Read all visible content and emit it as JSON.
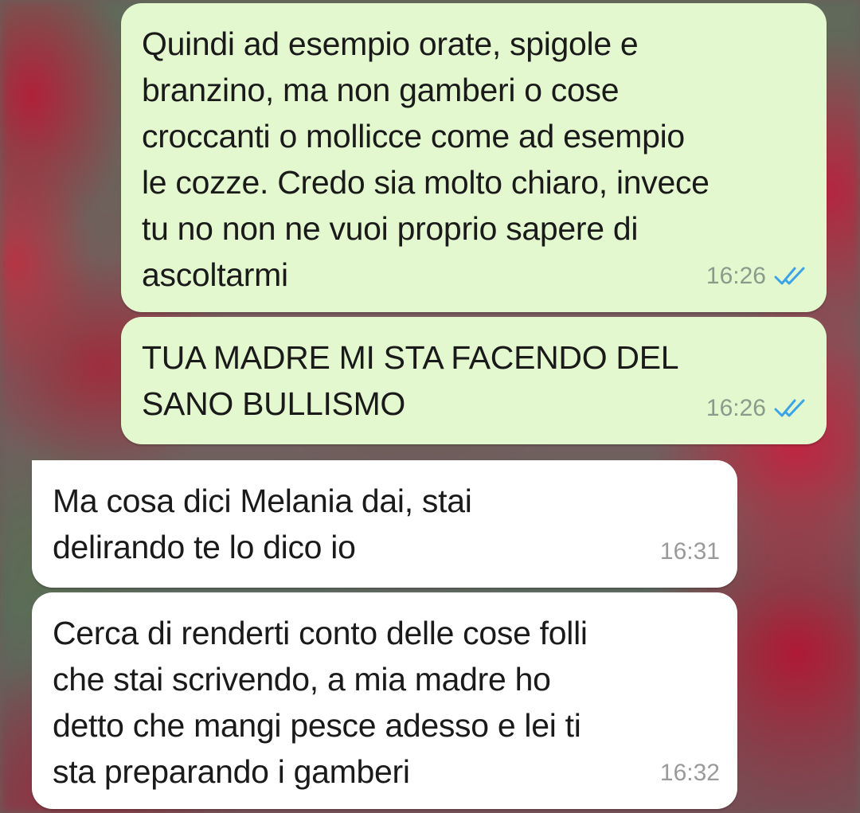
{
  "colors": {
    "outgoing_bubble": "#e3f8cf",
    "incoming_bubble": "#ffffff",
    "read_ticks": "#3aa4e6"
  },
  "messages": [
    {
      "direction": "outgoing",
      "text": "Quindi ad esempio orate, spigole e\nbranzino, ma non gamberi o cose\ncroccanti o mollicce come ad esempio\nle cozze. Credo sia molto chiaro, invece\ntu no non ne vuoi proprio sapere di\nascoltarmi",
      "time": "16:26",
      "status_icon": "double-check-read"
    },
    {
      "direction": "outgoing",
      "text": "TUA MADRE MI STA FACENDO DEL\nSANO BULLISMO",
      "time": "16:26",
      "status_icon": "double-check-read"
    },
    {
      "direction": "incoming",
      "text": "Ma cosa dici Melania dai, stai\ndelirando te lo dico io",
      "time": "16:31"
    },
    {
      "direction": "incoming",
      "text": "Cerca di renderti conto delle cose folli\nche stai scrivendo, a mia madre ho\ndetto che mangi pesce adesso e lei ti\nsta preparando i gamberi",
      "time": "16:32"
    }
  ]
}
